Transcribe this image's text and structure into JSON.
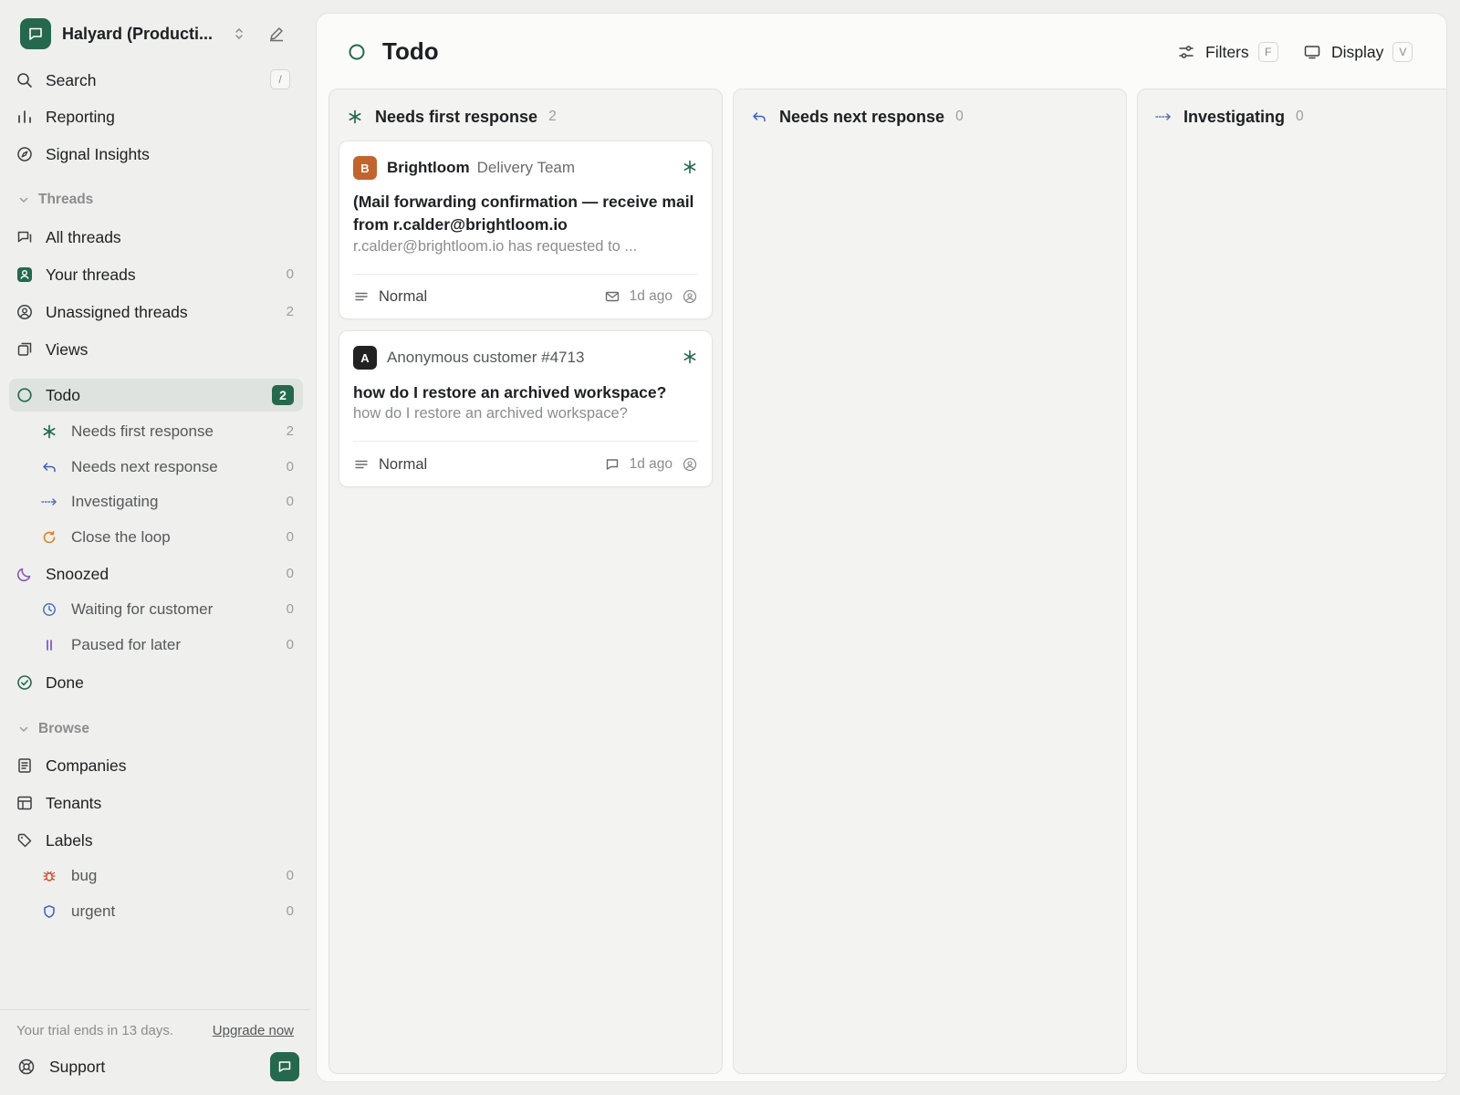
{
  "colors": {
    "brand": "#26684e",
    "active_bg": "#dfe3df",
    "investigating": "#5b6fb5",
    "close_loop": "#d9822b",
    "snoozed": "#8a5bb5",
    "waiting": "#4a6fc2",
    "paused": "#7a56b8",
    "bug": "#c0502b",
    "urgent": "#3b5fc0",
    "brightloom_avatar": "#c0652f",
    "anon_avatar": "#222222"
  },
  "workspace": {
    "name": "Halyard (Producti...",
    "logo_icon": "chat-bubble-icon"
  },
  "sidebar": {
    "top_items": [
      {
        "label": "Search",
        "icon": "search-icon",
        "shortcut": "/"
      },
      {
        "label": "Reporting",
        "icon": "bar-chart-icon"
      },
      {
        "label": "Signal Insights",
        "icon": "compass-icon"
      }
    ],
    "threads_section": "Threads",
    "threads": [
      {
        "label": "All threads",
        "icon": "threads-icon",
        "count": ""
      },
      {
        "label": "Your threads",
        "icon": "person-icon",
        "count": "0"
      },
      {
        "label": "Unassigned threads",
        "icon": "user-circle-icon",
        "count": "2"
      },
      {
        "label": "Views",
        "icon": "views-icon",
        "count": ""
      }
    ],
    "todo": {
      "label": "Todo",
      "count": "2"
    },
    "todo_sub": [
      {
        "label": "Needs first response",
        "count": "2"
      },
      {
        "label": "Needs next response",
        "count": "0"
      },
      {
        "label": "Investigating",
        "count": "0"
      },
      {
        "label": "Close the loop",
        "count": "0"
      }
    ],
    "snoozed": {
      "label": "Snoozed",
      "count": "0"
    },
    "snoozed_sub": [
      {
        "label": "Waiting for customer",
        "count": "0"
      },
      {
        "label": "Paused for later",
        "count": "0"
      }
    ],
    "done": {
      "label": "Done"
    },
    "browse_section": "Browse",
    "browse": [
      {
        "label": "Companies",
        "icon": "document-icon"
      },
      {
        "label": "Tenants",
        "icon": "table-icon"
      },
      {
        "label": "Labels",
        "icon": "tag-icon"
      }
    ],
    "labels_sub": [
      {
        "label": "bug",
        "count": "0"
      },
      {
        "label": "urgent",
        "count": "0"
      }
    ],
    "trial_text": "Your trial ends in 13 days.",
    "upgrade_label": "Upgrade now",
    "support_label": "Support"
  },
  "main": {
    "title": "Todo",
    "filters_label": "Filters",
    "filters_key": "F",
    "display_label": "Display",
    "display_key": "V",
    "columns": [
      {
        "title": "Needs first response",
        "count": "2"
      },
      {
        "title": "Needs next response",
        "count": "0"
      },
      {
        "title": "Investigating",
        "count": "0"
      }
    ],
    "cards": [
      {
        "avatar": "B",
        "company": "Brightloom",
        "team": "Delivery Team",
        "subject": "(Mail forwarding confirmation — receive mail from r.calder@brightloom.io",
        "preview": "r.calder@brightloom.io has requested to ...",
        "priority": "Normal",
        "channel_icon": "mail-icon",
        "time": "1d ago"
      },
      {
        "avatar": "A",
        "customer": "Anonymous customer #4713",
        "subject": "how do I restore an archived workspace?",
        "preview": "how do I restore an archived workspace?",
        "priority": "Normal",
        "channel_icon": "chat-bubble-icon",
        "time": "1d ago"
      }
    ]
  }
}
